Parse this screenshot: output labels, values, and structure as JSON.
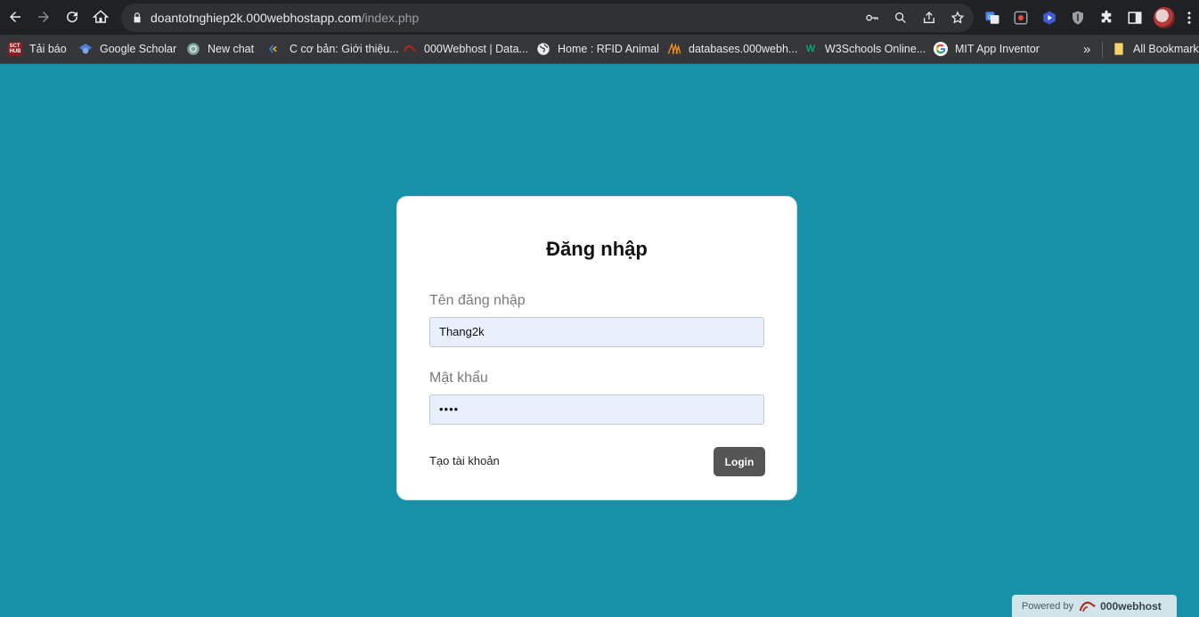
{
  "browser": {
    "url_host": "doantotnghiep2k.000webhostapp.com",
    "url_path": "/index.php",
    "bookmarks": [
      {
        "label": "Tải báo",
        "icon": "sct-hub-icon",
        "color": "#c0392b"
      },
      {
        "label": "Google Scholar",
        "icon": "scholar-cap-icon",
        "color": "#4a7fd6"
      },
      {
        "label": "New chat",
        "icon": "chatgpt-icon",
        "color": "#8ab4a8"
      },
      {
        "label": "C cơ bản: Giới thiệu...",
        "icon": "c-lang-icon",
        "color": "#e2a33a"
      },
      {
        "label": "000Webhost | Data...",
        "icon": "webhost-icon",
        "color": "#b3261e"
      },
      {
        "label": "Home : RFID Animal",
        "icon": "globe-icon",
        "color": "#e8eaed"
      },
      {
        "label": "databases.000webh...",
        "icon": "phpmyadmin-icon",
        "color": "#f29111"
      },
      {
        "label": "W3Schools Online...",
        "icon": "w3schools-icon",
        "color": "#04aa6d"
      },
      {
        "label": "MIT App Inventor",
        "icon": "google-icon",
        "color": "#4285f4"
      }
    ],
    "overflow_label": "»",
    "all_bookmarks_label": "All Bookmarks"
  },
  "login": {
    "title": "Đăng nhập",
    "username_label": "Tên đăng nhập",
    "username_value": "Thang2k",
    "password_label": "Mật khẩu",
    "password_value": "••••",
    "create_account_label": "Tạo tài khoản",
    "login_button_label": "Login"
  },
  "footer": {
    "powered_by": "Powered by",
    "brand": "000webhost"
  },
  "colors": {
    "page_background": "#1791a8",
    "input_background": "#e8f0fe",
    "button_background": "#555555"
  }
}
